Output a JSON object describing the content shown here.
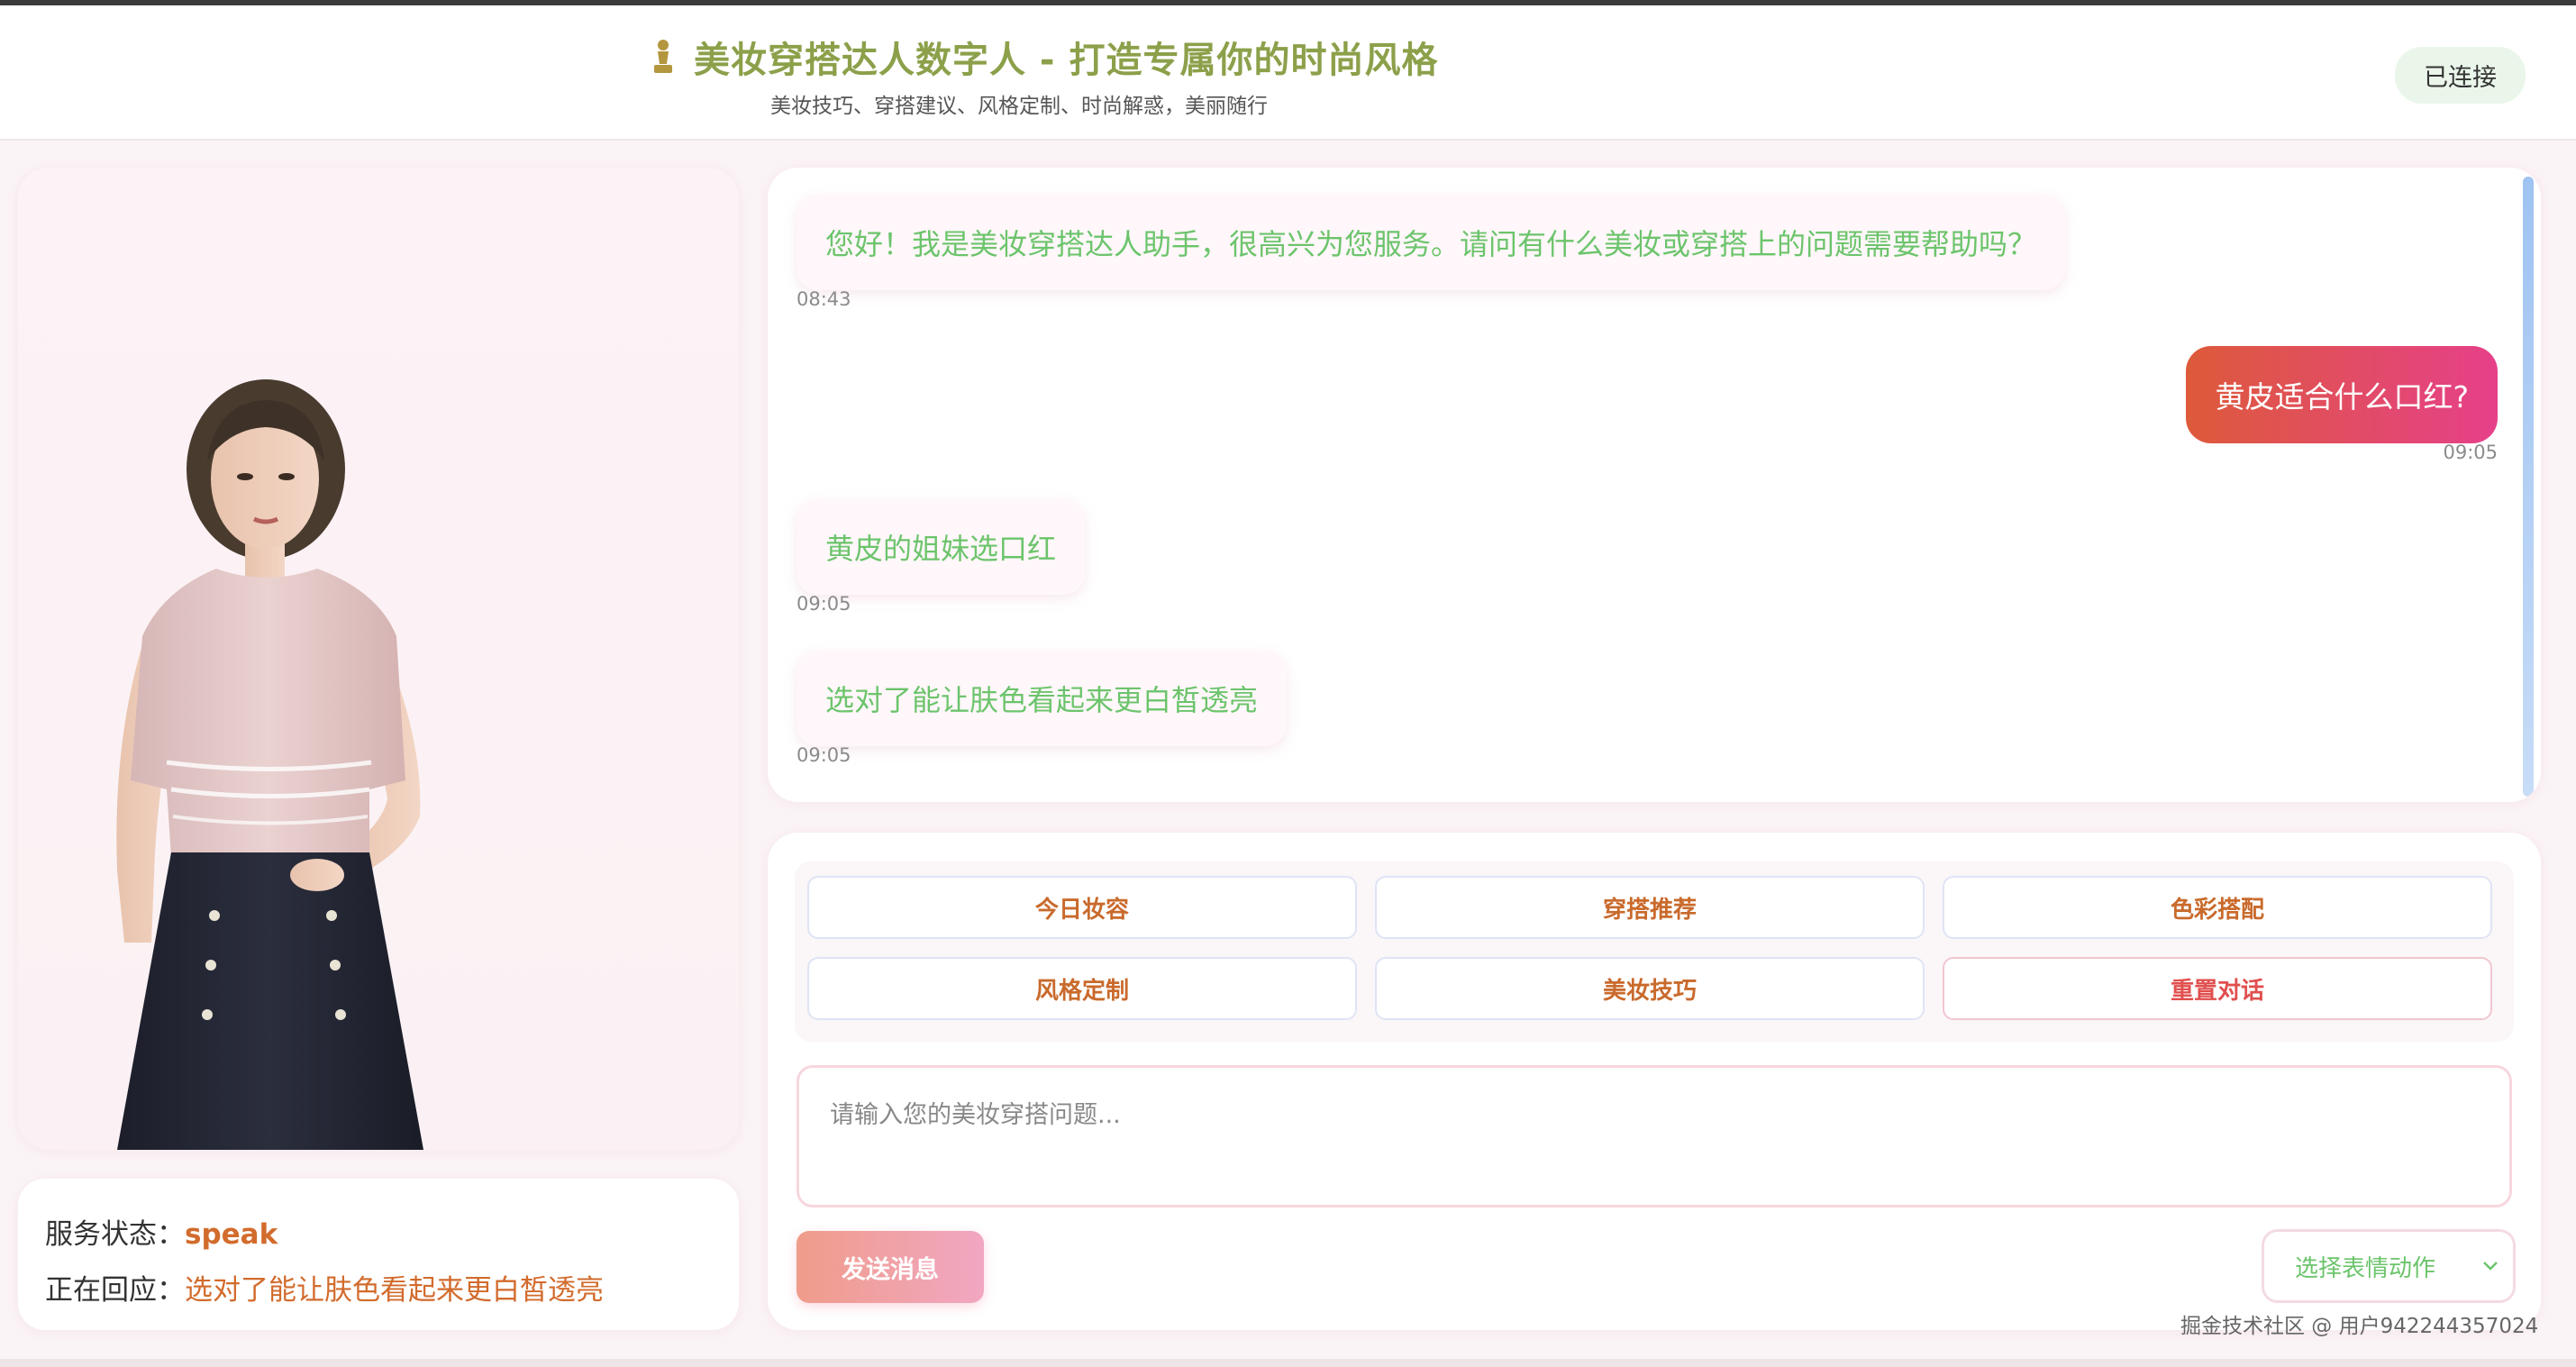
{
  "header": {
    "title": "美妆穿搭达人数字人 - 打造专属你的时尚风格",
    "subtitle": "美妆技巧、穿搭建议、风格定制、时尚解惑，美丽随行",
    "connection_status": "已连接"
  },
  "status_panel": {
    "service_label": "服务状态：",
    "service_value": "speak",
    "responding_label": "正在回应：",
    "responding_value": "选对了能让肤色看起来更白皙透亮"
  },
  "chat": {
    "messages": [
      {
        "role": "bot",
        "text": "您好！我是美妆穿搭达人助手，很高兴为您服务。请问有什么美妆或穿搭上的问题需要帮助吗？",
        "time": "08:43"
      },
      {
        "role": "user",
        "text": "黄皮适合什么口红?",
        "time": "09:05"
      },
      {
        "role": "bot",
        "text": "黄皮的姐妹选口红",
        "time": "09:05"
      },
      {
        "role": "bot",
        "text": "选对了能让肤色看起来更白皙透亮",
        "time": "09:05"
      }
    ]
  },
  "quick_actions": [
    {
      "label": "今日妆容"
    },
    {
      "label": "穿搭推荐"
    },
    {
      "label": "色彩搭配"
    },
    {
      "label": "风格定制"
    },
    {
      "label": "美妆技巧"
    },
    {
      "label": "重置对话"
    }
  ],
  "input": {
    "placeholder": "请输入您的美妆穿搭问题...",
    "value": ""
  },
  "send_button": "发送消息",
  "expression_select": {
    "selected": "选择表情动作"
  },
  "watermark": "掘金技术社区 @ 用户942244357024",
  "colors": {
    "title": "#8ca04a",
    "bot_text": "#6cc46c",
    "accent_orange": "#d26b2c",
    "user_bubble_start": "#dd5a3a",
    "user_bubble_end": "#e6408a"
  }
}
